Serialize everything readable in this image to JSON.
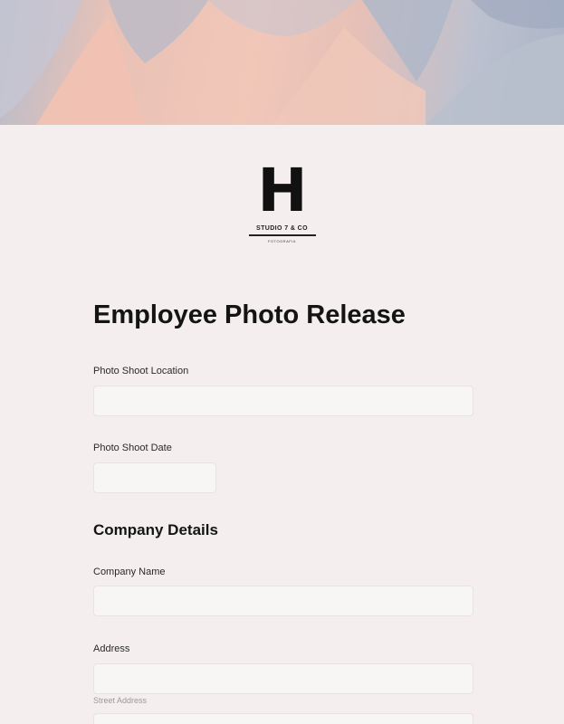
{
  "brand": {
    "logo_letter": "H",
    "logo_name": "STUDIO 7 & CO",
    "logo_tagline": "FOTOGRAFIA"
  },
  "form": {
    "title": "Employee Photo Release",
    "fields": {
      "location": {
        "label": "Photo Shoot Location",
        "value": ""
      },
      "date": {
        "label": "Photo Shoot Date",
        "value": ""
      },
      "company_name": {
        "label": "Company Name",
        "value": ""
      },
      "address": {
        "label": "Address",
        "value": "",
        "sublabel": "Street Address"
      }
    },
    "sections": {
      "company": "Company Details"
    }
  },
  "colors": {
    "page_background": "#f4eeee",
    "field_background": "#f8f6f5",
    "banner_peach": "#f1c7b8",
    "banner_blue": "#aab4c6"
  }
}
